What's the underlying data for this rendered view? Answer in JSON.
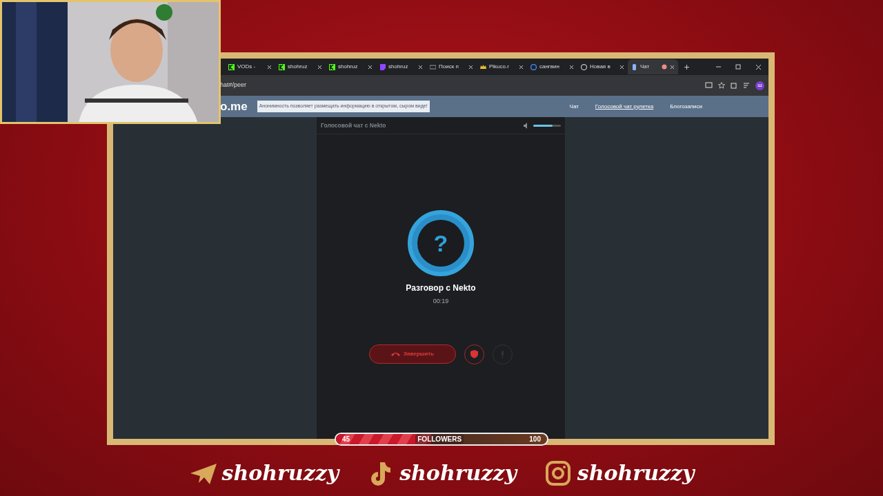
{
  "browser": {
    "tabs": [
      {
        "label": "VODs - ",
        "kind": "kick",
        "selected": false
      },
      {
        "label": "shohruz",
        "kind": "kick",
        "selected": false
      },
      {
        "label": "shohruz",
        "kind": "kick",
        "selected": false
      },
      {
        "label": "shohruz",
        "kind": "twitch",
        "selected": false
      },
      {
        "label": "Поиск п",
        "kind": "page",
        "selected": false
      },
      {
        "label": "Pikuco.r",
        "kind": "crown",
        "selected": false
      },
      {
        "label": "сангвин",
        "kind": "google",
        "selected": false
      },
      {
        "label": "Новая в",
        "kind": "chrome",
        "selected": false
      },
      {
        "label": "Чат",
        "kind": "mic",
        "selected": true,
        "recording": true
      }
    ],
    "address": "hat#/peer",
    "profile_initial": "ш"
  },
  "site": {
    "logo": "o.me",
    "banner": "Анонимность позволяет размещать информацию в открытом, сыром виде!",
    "nav": [
      {
        "label": "Чат",
        "selected": false
      },
      {
        "label": "Голосовой чат рулетка",
        "selected": true
      },
      {
        "label": "Блогозаписи",
        "selected": false
      }
    ]
  },
  "call": {
    "panel_title": "Голосовой чат с Nekto",
    "volume": {
      "level": 0.7
    },
    "avatar_glyph": "?",
    "title": "Разговор с Nekto",
    "timer": "00:19",
    "end_button": "Завершить",
    "mic_disabled": true
  },
  "followers": {
    "current": "45",
    "label": "FOLLOWERS",
    "goal": "100",
    "level": 0.45
  },
  "socials": [
    {
      "kind": "telegram",
      "handle": "shohruzzy"
    },
    {
      "kind": "tiktok",
      "handle": "shohruzzy"
    },
    {
      "kind": "instagram",
      "handle": "shohruzzy"
    }
  ]
}
